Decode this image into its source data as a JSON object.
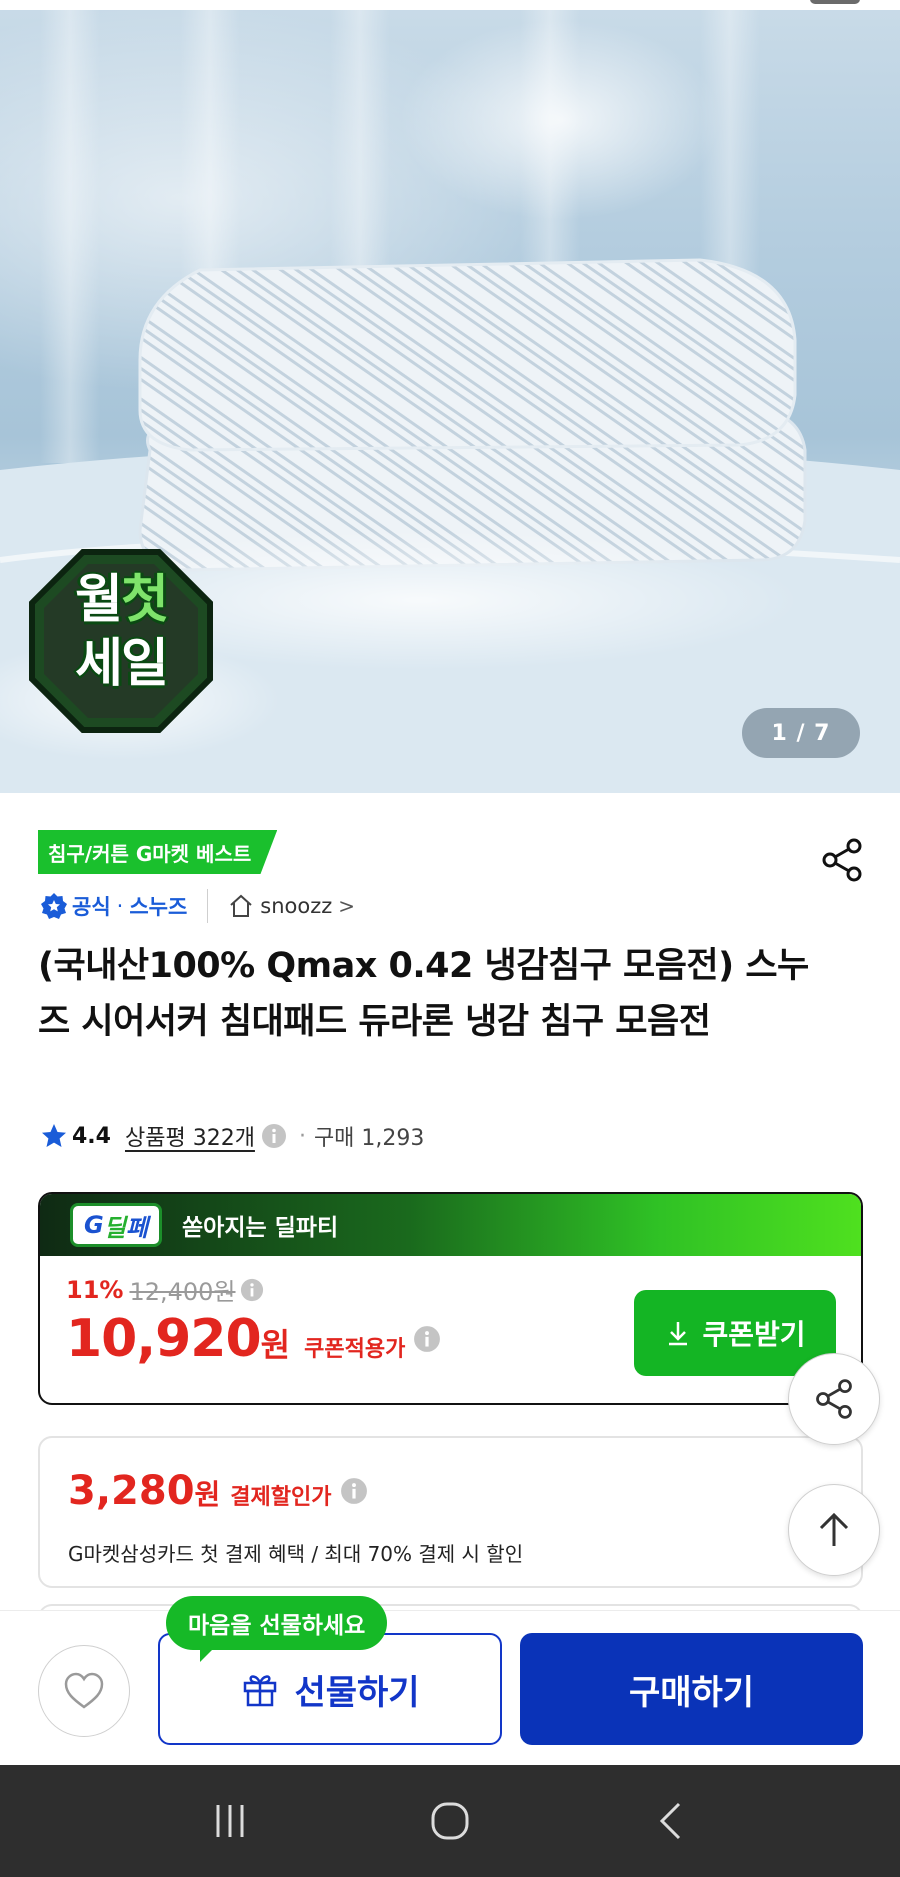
{
  "hero": {
    "badge_line1_a": "월",
    "badge_line1_b": "첫",
    "badge_line2": "세일",
    "image_counter": "1 / 7"
  },
  "product": {
    "best_tag": "침구/커튼 G마켓 베스트",
    "seller": {
      "official_label": "공식",
      "separator": "·",
      "brand": "스누즈",
      "store_name": "snoozz",
      "store_chevron": ">"
    },
    "title": "(국내산100% Qmax 0.42 냉감침구 모음전) 스누즈 시어서커 침대패드 듀라론 냉감 침구 모음전",
    "rating": {
      "score": "4.4",
      "review_label": "상품평 322개",
      "bullet": "·",
      "purchase_count": "구매 1,293"
    }
  },
  "deal": {
    "logo_a": "G",
    "logo_b": "딜",
    "logo_c": "페",
    "header_text": "쏟아지는 딜파티",
    "discount_pct": "11%",
    "original_price": "12,400원",
    "final_price": "10,920",
    "currency": "원",
    "final_label": "쿠폰적용가",
    "coupon_button": "쿠폰받기"
  },
  "card_discount": {
    "amount": "3,280",
    "currency": "원",
    "label": "결제할인가",
    "benefit": "G마켓삼성카드 첫 결제 혜택 / 최대 70% 결제 시 할인"
  },
  "actions": {
    "gift_tooltip": "마음을 선물하세요",
    "gift_button": "선물하기",
    "buy_button": "구매하기"
  },
  "icons": {
    "share": "share-icon",
    "scroll_top": "arrow-up-icon",
    "wish": "heart-icon",
    "gift": "gift-icon",
    "download": "download-icon",
    "star": "star-icon",
    "info": "info-icon",
    "home": "home-icon",
    "official": "official-badge-icon",
    "nav_recent": "recent-apps-icon",
    "nav_home": "home-circle-icon",
    "nav_back": "back-icon"
  },
  "colors": {
    "accent_green": "#1ac02d",
    "price_red": "#e2261f",
    "primary_blue": "#0a33b8",
    "brand_blue": "#1a5cd8"
  }
}
